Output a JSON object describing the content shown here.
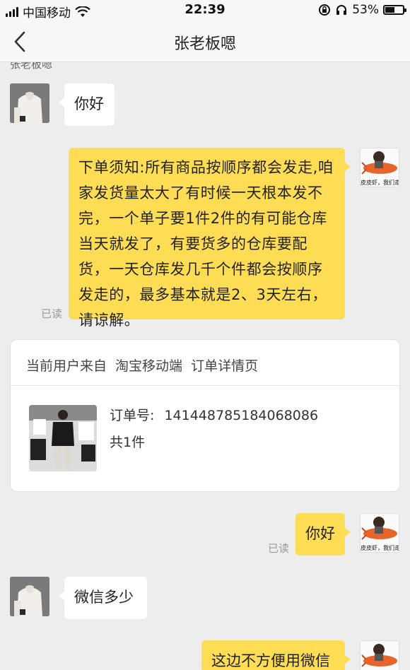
{
  "status_bar": {
    "carrier": "中国移动",
    "time": "22:39",
    "battery_percent": "53%",
    "battery_level": 0.53,
    "icons": [
      "signal-icon",
      "wifi-icon",
      "orientation-lock-icon",
      "headphones-icon",
      "battery-icon"
    ]
  },
  "nav": {
    "title": "张老板嗯",
    "back_icon": "chevron-left-icon"
  },
  "chat": {
    "sender_name_partial": "张老板嗯",
    "avatar_caption": "皮皮虾，我们走",
    "messages": [
      {
        "side": "left",
        "text": "你好"
      },
      {
        "side": "right",
        "text": "下单须知:所有商品按顺序都会发走,咱家发货量太大了有时候一天根本发不完，一个单子要1件2件的有可能仓库当天就发了，有要货多的仓库要配货，一天仓库发几千个件都会按顺序发走的，最多基本就是2、3天左右，请谅解。",
        "status": "已读"
      },
      {
        "side": "right",
        "text": "你好",
        "status": "已读"
      },
      {
        "side": "left",
        "text": "微信多少"
      },
      {
        "side": "right",
        "text": "这边不方便用微信"
      }
    ]
  },
  "order_card": {
    "source": "当前用户来自 淘宝移动端 订单详情页",
    "order_number_label": "订单号:",
    "order_number": "141448785184068086",
    "count": "共1件"
  },
  "colors": {
    "background": "#ededed",
    "bubble_self": "#fedc54",
    "bubble_other": "#ffffff",
    "read_text": "#999999"
  }
}
